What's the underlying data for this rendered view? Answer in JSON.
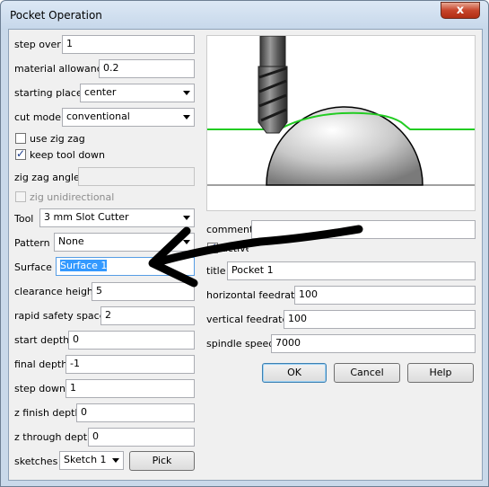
{
  "window": {
    "title": "Pocket Operation",
    "close_glyph": "x"
  },
  "left": {
    "step_over": {
      "label": "step over",
      "value": "1"
    },
    "material_allowance": {
      "label": "material allowance",
      "value": "0.2"
    },
    "starting_place": {
      "label": "starting place",
      "value": "center"
    },
    "cut_mode": {
      "label": "cut mode",
      "value": "conventional"
    },
    "use_zig_zag": {
      "label": "use zig zag",
      "checked": false
    },
    "keep_tool_down": {
      "label": "keep tool down",
      "checked": true
    },
    "zig_zag_angle": {
      "label": "zig zag angle",
      "value": ""
    },
    "zig_unidirectional": {
      "label": "zig unidirectional",
      "checked": false
    },
    "tool": {
      "label": "Tool",
      "value": "3 mm Slot Cutter"
    },
    "pattern": {
      "label": "Pattern",
      "value": "None"
    },
    "surface": {
      "label": "Surface",
      "value": "Surface 1"
    },
    "clearance_height": {
      "label": "clearance height",
      "value": "5"
    },
    "rapid_safety_space": {
      "label": "rapid safety space",
      "value": "2"
    },
    "start_depth": {
      "label": "start depth",
      "value": "0"
    },
    "final_depth": {
      "label": "final depth",
      "value": "-1"
    },
    "step_down": {
      "label": "step down",
      "value": "1"
    },
    "z_finish_depth": {
      "label": "z finish depth",
      "value": "0"
    },
    "z_through_depth": {
      "label": "z through depth",
      "value": "0"
    },
    "sketches": {
      "label": "sketches",
      "value": "Sketch 1",
      "pick_label": "Pick"
    }
  },
  "right": {
    "comment": {
      "label": "comment",
      "value": ""
    },
    "active": {
      "label": "active",
      "checked": true
    },
    "title": {
      "label": "title",
      "value": "Pocket 1"
    },
    "horizontal_feedrate": {
      "label": "horizontal feedrate",
      "value": "100"
    },
    "vertical_feedrate": {
      "label": "vertical feedrate",
      "value": "100"
    },
    "spindle_speed": {
      "label": "spindle speed",
      "value": "7000"
    },
    "ok_label": "OK",
    "cancel_label": "Cancel",
    "help_label": "Help"
  },
  "colors": {
    "toolpath": "#22cc22",
    "annotation_arrow": "#000000",
    "selection": "#3399ff"
  }
}
